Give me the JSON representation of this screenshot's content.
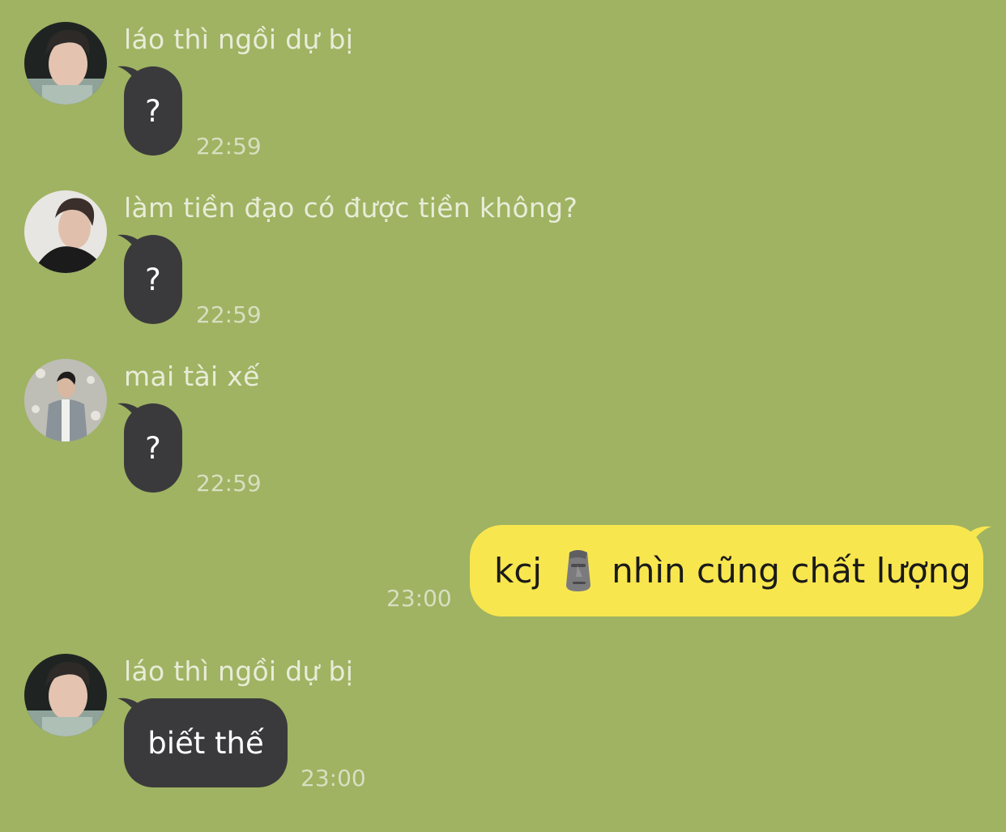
{
  "messages": [
    {
      "sender": "láo thì ngồi dự bị",
      "text": "?",
      "time": "22:59"
    },
    {
      "sender": "làm tiền đạo có được tiền không?",
      "text": "?",
      "time": "22:59"
    },
    {
      "sender": "mai tài xế",
      "text": "?",
      "time": "22:59"
    },
    {
      "outgoing": true,
      "text_before": "kcj",
      "emoji": "moai-emoji",
      "text_after": "nhìn cũng chất lượng",
      "time": "23:00"
    },
    {
      "sender": "láo thì ngồi dự bị",
      "text": "biết thế",
      "time": "23:00"
    }
  ],
  "colors": {
    "background": "#9fb362",
    "incoming_bubble": "#3a3a3c",
    "outgoing_bubble": "#f8e64e"
  },
  "icons": {
    "moai": "moai-emoji"
  }
}
